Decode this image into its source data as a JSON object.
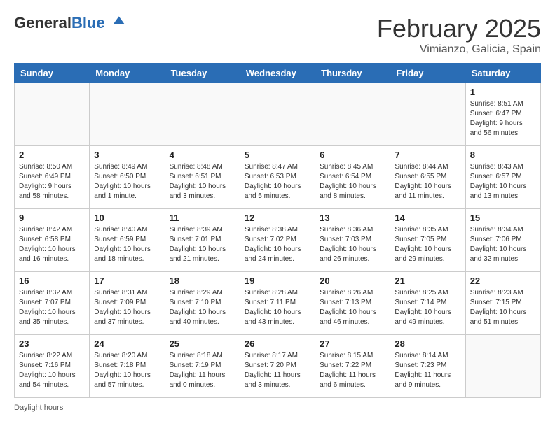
{
  "header": {
    "logo_general": "General",
    "logo_blue": "Blue",
    "month_title": "February 2025",
    "location": "Vimianzo, Galicia, Spain"
  },
  "days_of_week": [
    "Sunday",
    "Monday",
    "Tuesday",
    "Wednesday",
    "Thursday",
    "Friday",
    "Saturday"
  ],
  "weeks": [
    [
      {
        "day": "",
        "info": ""
      },
      {
        "day": "",
        "info": ""
      },
      {
        "day": "",
        "info": ""
      },
      {
        "day": "",
        "info": ""
      },
      {
        "day": "",
        "info": ""
      },
      {
        "day": "",
        "info": ""
      },
      {
        "day": "1",
        "info": "Sunrise: 8:51 AM\nSunset: 6:47 PM\nDaylight: 9 hours and 56 minutes."
      }
    ],
    [
      {
        "day": "2",
        "info": "Sunrise: 8:50 AM\nSunset: 6:49 PM\nDaylight: 9 hours and 58 minutes."
      },
      {
        "day": "3",
        "info": "Sunrise: 8:49 AM\nSunset: 6:50 PM\nDaylight: 10 hours and 1 minute."
      },
      {
        "day": "4",
        "info": "Sunrise: 8:48 AM\nSunset: 6:51 PM\nDaylight: 10 hours and 3 minutes."
      },
      {
        "day": "5",
        "info": "Sunrise: 8:47 AM\nSunset: 6:53 PM\nDaylight: 10 hours and 5 minutes."
      },
      {
        "day": "6",
        "info": "Sunrise: 8:45 AM\nSunset: 6:54 PM\nDaylight: 10 hours and 8 minutes."
      },
      {
        "day": "7",
        "info": "Sunrise: 8:44 AM\nSunset: 6:55 PM\nDaylight: 10 hours and 11 minutes."
      },
      {
        "day": "8",
        "info": "Sunrise: 8:43 AM\nSunset: 6:57 PM\nDaylight: 10 hours and 13 minutes."
      }
    ],
    [
      {
        "day": "9",
        "info": "Sunrise: 8:42 AM\nSunset: 6:58 PM\nDaylight: 10 hours and 16 minutes."
      },
      {
        "day": "10",
        "info": "Sunrise: 8:40 AM\nSunset: 6:59 PM\nDaylight: 10 hours and 18 minutes."
      },
      {
        "day": "11",
        "info": "Sunrise: 8:39 AM\nSunset: 7:01 PM\nDaylight: 10 hours and 21 minutes."
      },
      {
        "day": "12",
        "info": "Sunrise: 8:38 AM\nSunset: 7:02 PM\nDaylight: 10 hours and 24 minutes."
      },
      {
        "day": "13",
        "info": "Sunrise: 8:36 AM\nSunset: 7:03 PM\nDaylight: 10 hours and 26 minutes."
      },
      {
        "day": "14",
        "info": "Sunrise: 8:35 AM\nSunset: 7:05 PM\nDaylight: 10 hours and 29 minutes."
      },
      {
        "day": "15",
        "info": "Sunrise: 8:34 AM\nSunset: 7:06 PM\nDaylight: 10 hours and 32 minutes."
      }
    ],
    [
      {
        "day": "16",
        "info": "Sunrise: 8:32 AM\nSunset: 7:07 PM\nDaylight: 10 hours and 35 minutes."
      },
      {
        "day": "17",
        "info": "Sunrise: 8:31 AM\nSunset: 7:09 PM\nDaylight: 10 hours and 37 minutes."
      },
      {
        "day": "18",
        "info": "Sunrise: 8:29 AM\nSunset: 7:10 PM\nDaylight: 10 hours and 40 minutes."
      },
      {
        "day": "19",
        "info": "Sunrise: 8:28 AM\nSunset: 7:11 PM\nDaylight: 10 hours and 43 minutes."
      },
      {
        "day": "20",
        "info": "Sunrise: 8:26 AM\nSunset: 7:13 PM\nDaylight: 10 hours and 46 minutes."
      },
      {
        "day": "21",
        "info": "Sunrise: 8:25 AM\nSunset: 7:14 PM\nDaylight: 10 hours and 49 minutes."
      },
      {
        "day": "22",
        "info": "Sunrise: 8:23 AM\nSunset: 7:15 PM\nDaylight: 10 hours and 51 minutes."
      }
    ],
    [
      {
        "day": "23",
        "info": "Sunrise: 8:22 AM\nSunset: 7:16 PM\nDaylight: 10 hours and 54 minutes."
      },
      {
        "day": "24",
        "info": "Sunrise: 8:20 AM\nSunset: 7:18 PM\nDaylight: 10 hours and 57 minutes."
      },
      {
        "day": "25",
        "info": "Sunrise: 8:18 AM\nSunset: 7:19 PM\nDaylight: 11 hours and 0 minutes."
      },
      {
        "day": "26",
        "info": "Sunrise: 8:17 AM\nSunset: 7:20 PM\nDaylight: 11 hours and 3 minutes."
      },
      {
        "day": "27",
        "info": "Sunrise: 8:15 AM\nSunset: 7:22 PM\nDaylight: 11 hours and 6 minutes."
      },
      {
        "day": "28",
        "info": "Sunrise: 8:14 AM\nSunset: 7:23 PM\nDaylight: 11 hours and 9 minutes."
      },
      {
        "day": "",
        "info": ""
      }
    ]
  ],
  "footer": {
    "note_label": "Daylight hours"
  }
}
